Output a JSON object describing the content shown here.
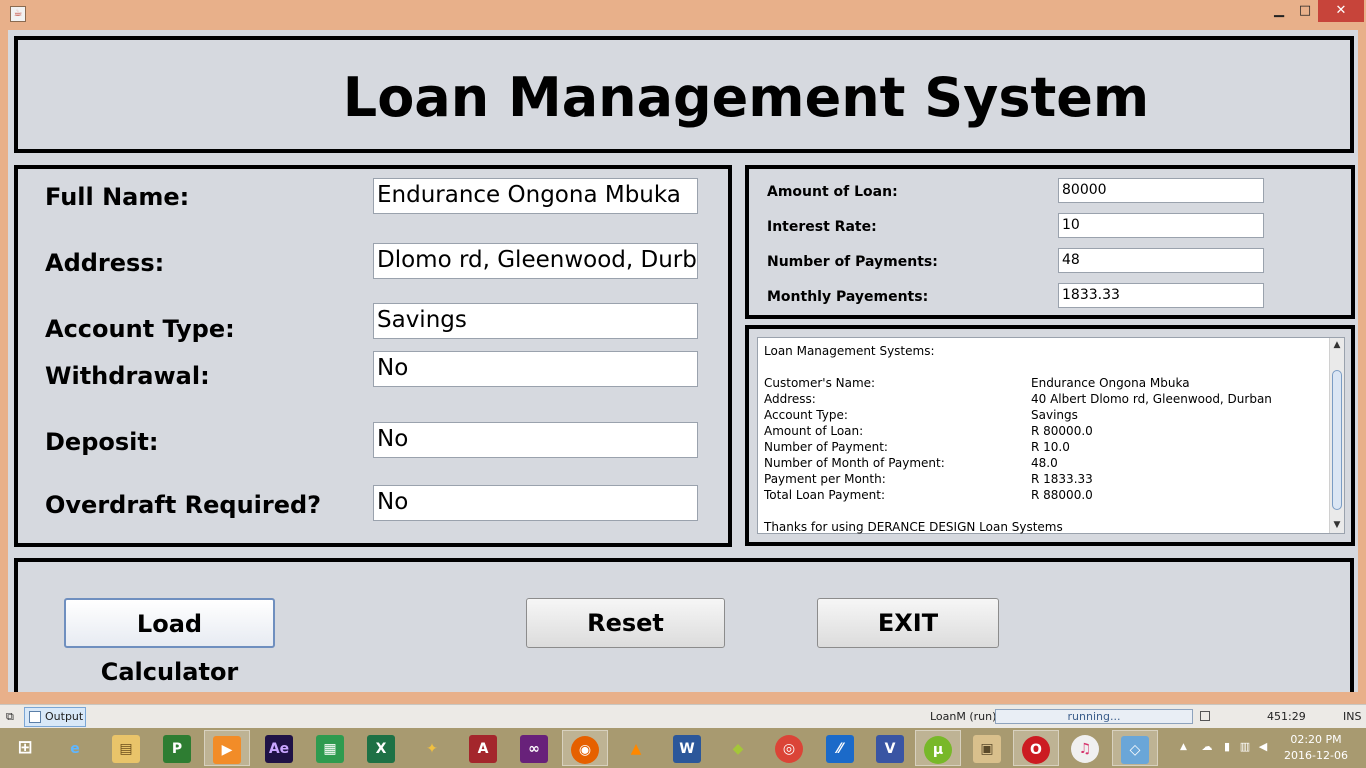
{
  "window": {
    "app_icon": "java-cup-icon",
    "minimize_glyph": "▁",
    "maximize_glyph": "□",
    "close_glyph": "✕"
  },
  "header": {
    "title": "Loan Management System"
  },
  "customer": {
    "full_name_label": "Full Name:",
    "full_name_value": "Endurance Ongona Mbuka",
    "address_label": "Address:",
    "address_value": "Dlomo rd, Gleenwood, Durban",
    "account_type_label": "Account Type:",
    "account_type_value": "Savings",
    "withdrawal_label": "Withdrawal:",
    "withdrawal_value": "No",
    "deposit_label": "Deposit:",
    "deposit_value": "No",
    "overdraft_label": "Overdraft Required?",
    "overdraft_value": "No"
  },
  "loan": {
    "amount_label": "Amount of Loan:",
    "amount_value": "80000",
    "interest_label": "Interest Rate:",
    "interest_value": "10",
    "payments_label": "Number of Payments:",
    "payments_value": "48",
    "monthly_label": "Monthly Payements:",
    "monthly_value": "1833.33"
  },
  "receipt": {
    "heading": "Loan Management Systems:",
    "rows": [
      {
        "label": "Customer's Name:",
        "value": "Endurance Ongona Mbuka"
      },
      {
        "label": "Address:",
        "value": "40 Albert Dlomo rd, Gleenwood, Durban"
      },
      {
        "label": "Account Type:",
        "value": "Savings"
      },
      {
        "label": "Amount of Loan:",
        "value": "R 80000.0"
      },
      {
        "label": "Number of Payment:",
        "value": "R 10.0"
      },
      {
        "label": "Number of Month of Payment:",
        "value": "48.0"
      },
      {
        "label": "Payment per Month:",
        "value": "R 1833.33"
      },
      {
        "label": "Total Loan Payment:",
        "value": "R 88000.0"
      }
    ],
    "footer": "Thanks for using DERANCE DESIGN Loan Systems"
  },
  "buttons": {
    "calculator": "Load Calculator",
    "reset": "Reset",
    "exit": "EXIT"
  },
  "ide_status": {
    "output_tab": "Output",
    "run_label": "LoanM (run)",
    "progress_text": "running...",
    "caret_position": "451:29",
    "insert_mode": "INS"
  },
  "taskbar": {
    "apps": [
      {
        "name": "start-button",
        "glyph": "⊞"
      },
      {
        "name": "internet-explorer-icon",
        "glyph": "e"
      },
      {
        "name": "file-explorer-icon",
        "glyph": "▤"
      },
      {
        "name": "project-icon",
        "glyph": "P"
      },
      {
        "name": "media-player-icon",
        "glyph": "▶"
      },
      {
        "name": "after-effects-icon",
        "glyph": "Ae"
      },
      {
        "name": "store-icon",
        "glyph": "▦"
      },
      {
        "name": "excel-icon",
        "glyph": "X"
      },
      {
        "name": "tools-icon",
        "glyph": "✦"
      },
      {
        "name": "access-icon",
        "glyph": "A"
      },
      {
        "name": "visual-studio-icon",
        "glyph": "∞"
      },
      {
        "name": "firefox-icon",
        "glyph": "◉"
      },
      {
        "name": "vlc-icon",
        "glyph": "▲"
      },
      {
        "name": "word-icon",
        "glyph": "W"
      },
      {
        "name": "android-studio-icon",
        "glyph": "◆"
      },
      {
        "name": "chrome-icon",
        "glyph": "◎"
      },
      {
        "name": "netbeans-icon",
        "glyph": "⁄⁄"
      },
      {
        "name": "visio-icon",
        "glyph": "V"
      },
      {
        "name": "utorrent-icon",
        "glyph": "µ"
      },
      {
        "name": "installer-icon",
        "glyph": "▣"
      },
      {
        "name": "opera-icon",
        "glyph": "O"
      },
      {
        "name": "itunes-icon",
        "glyph": "♫"
      },
      {
        "name": "virtualbox-icon",
        "glyph": "◇"
      }
    ],
    "colors": {
      "taskbar_bg": "#a89a70",
      "window_frame": "#e8b08a",
      "panel_bg": "#d6d9df"
    }
  },
  "tray": {
    "time": "02:20 PM",
    "date": "2016-12-06"
  }
}
